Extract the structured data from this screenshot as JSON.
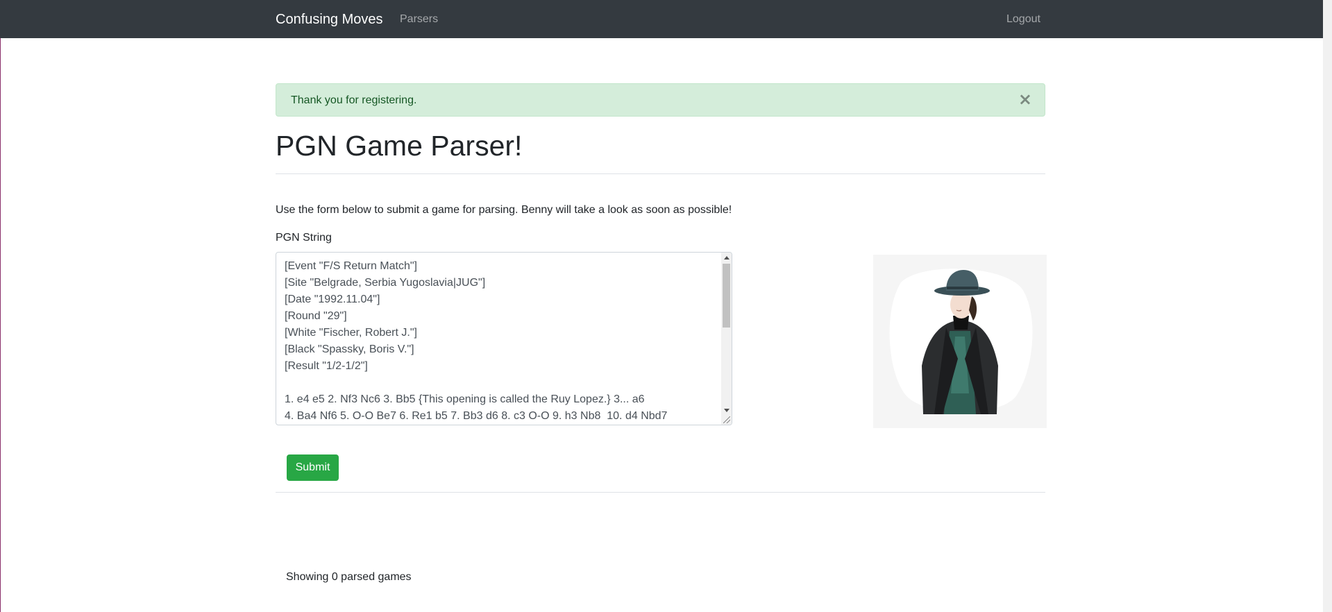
{
  "navbar": {
    "brand": "Confusing Moves",
    "links": [
      {
        "label": "Parsers"
      },
      {
        "label": "Logout"
      }
    ]
  },
  "alert": {
    "message": "Thank you for registering.",
    "close_glyph": "×"
  },
  "main": {
    "title": "PGN Game Parser!",
    "intro": "Use the form below to submit a game for parsing. Benny will take a look as soon as possible!",
    "pgn_label": "PGN String",
    "pgn_value": "[Event \"F/S Return Match\"]\n[Site \"Belgrade, Serbia Yugoslavia|JUG\"]\n[Date \"1992.11.04\"]\n[Round \"29\"]\n[White \"Fischer, Robert J.\"]\n[Black \"Spassky, Boris V.\"]\n[Result \"1/2-1/2\"]\n\n1. e4 e5 2. Nf3 Nc6 3. Bb5 {This opening is called the Ruy Lopez.} 3... a6\n4. Ba4 Nf6 5. O-O Be7 6. Re1 b5 7. Bb3 d6 8. c3 O-O 9. h3 Nb8  10. d4 Nbd7",
    "submit_label": "Submit",
    "games_count_text": "Showing 0 parsed games"
  },
  "colors": {
    "navbar_bg": "#343a40",
    "alert_bg": "#d4edda",
    "alert_text": "#155724",
    "submit_bg": "#28a745"
  },
  "icons": {
    "avatar": "avatar-illustration-man-in-fedora",
    "close": "close-icon"
  }
}
